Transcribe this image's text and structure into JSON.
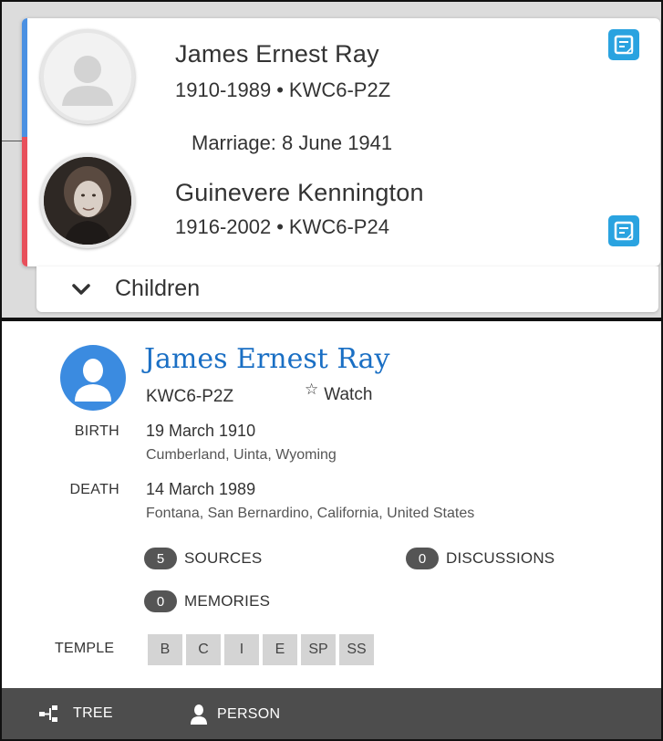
{
  "couple": {
    "husband": {
      "name": "James Ernest Ray",
      "lifespan": "1910-1989",
      "id": "KWC6-P2Z"
    },
    "marriage": "Marriage: 8 June 1941",
    "wife": {
      "name": "Guinevere Kennington",
      "lifespan": "1916-2002",
      "id": "KWC6-P24"
    },
    "separator": "•",
    "children_label": "Children"
  },
  "person": {
    "name": "James Ernest Ray",
    "id": "KWC6-P2Z",
    "watch_label": "Watch",
    "birth": {
      "label": "BIRTH",
      "date": "19 March 1910",
      "place": "Cumberland, Uinta, Wyoming"
    },
    "death": {
      "label": "DEATH",
      "date": "14 March 1989",
      "place": "Fontana, San Bernardino, California, United States"
    },
    "sources": {
      "count": "5",
      "label": "SOURCES"
    },
    "discussions": {
      "count": "0",
      "label": "DISCUSSIONS"
    },
    "memories": {
      "count": "0",
      "label": "MEMORIES"
    },
    "temple": {
      "label": "TEMPLE",
      "ordinances": [
        "B",
        "C",
        "I",
        "E",
        "SP",
        "SS"
      ]
    }
  },
  "nav": {
    "tree_label": "TREE",
    "person_label": "PERSON"
  },
  "colors": {
    "male": "#4a90e2",
    "female": "#e8505b",
    "link": "#1a6fc4",
    "card_icon": "#2aa3e0",
    "nav_bg": "#4d4d4d"
  },
  "icons": {
    "card_icon": "person-card-icon",
    "chevron": "chevron-down-icon",
    "watch": "star-outline-icon",
    "tree": "tree-icon",
    "person": "person-icon"
  }
}
